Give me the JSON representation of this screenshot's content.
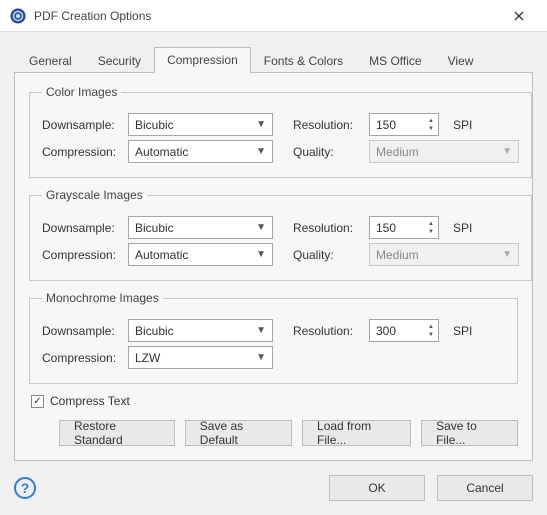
{
  "window": {
    "title": "PDF Creation Options"
  },
  "tabs": {
    "general": "General",
    "security": "Security",
    "compression": "Compression",
    "fonts_colors": "Fonts & Colors",
    "ms_office": "MS Office",
    "view": "View"
  },
  "labels": {
    "downsample": "Downsample:",
    "compression": "Compression:",
    "resolution": "Resolution:",
    "quality": "Quality:",
    "spi": "SPI"
  },
  "groups": {
    "color": {
      "legend": "Color Images",
      "downsample": "Bicubic",
      "compression": "Automatic",
      "resolution": "150",
      "quality": "Medium"
    },
    "grayscale": {
      "legend": "Grayscale Images",
      "downsample": "Bicubic",
      "compression": "Automatic",
      "resolution": "150",
      "quality": "Medium"
    },
    "mono": {
      "legend": "Monochrome Images",
      "downsample": "Bicubic",
      "compression": "LZW",
      "resolution": "300"
    }
  },
  "compress_text": {
    "label": "Compress Text",
    "checked": true
  },
  "buttons": {
    "restore": "Restore Standard",
    "save_default": "Save as Default",
    "load_file": "Load from File...",
    "save_file": "Save to File...",
    "ok": "OK",
    "cancel": "Cancel"
  }
}
